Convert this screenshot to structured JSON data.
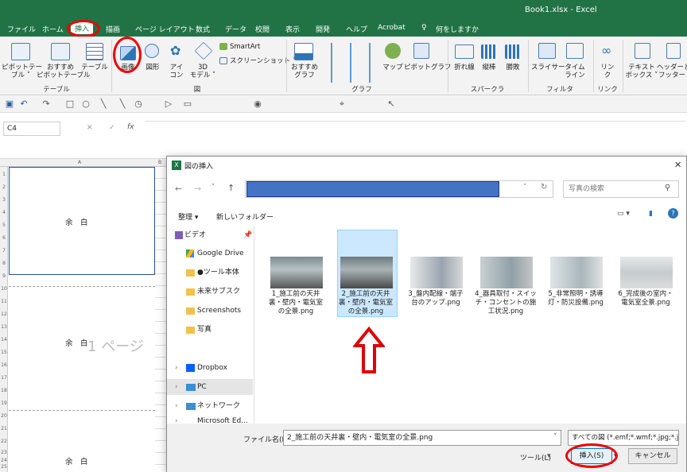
{
  "title": {
    "text": "Book1.xlsx  -  Excel"
  },
  "menu": [
    "ファイル",
    "ホーム",
    "挿入",
    "描画",
    "ページ レイアウト",
    "数式",
    "データ",
    "校閲",
    "表示",
    "開発",
    "ヘルプ",
    "Acrobat",
    "何をしますか"
  ],
  "ribbon": {
    "pivot": "ピボットテー\nブル ˅",
    "rec_pivot": "おすすめ\nピボットテーブル",
    "table": "テーブル",
    "image": "画像",
    "shape": "図形",
    "icon": "アイ\nコン",
    "model3d": "3D\nモデル ˅",
    "smartart": "SmartArt",
    "screenshot": "スクリーンショット ˅",
    "rec_chart": "おすすめ\nグラフ",
    "map": "マップ",
    "pivotchart": "ピボットグラフ",
    "line": "折れ線",
    "column": "縦棒",
    "winloss": "勝敗",
    "slicer": "スライサー",
    "timeline": "タイム\nライン",
    "link": "リン\nク",
    "textbox": "テキスト\nボックス ˅",
    "headerfooter": "ヘッダーと\nフッター",
    "group_table": "テーブル",
    "group_figure": "図",
    "group_chart": "グラフ",
    "group_spark": "スパークライン",
    "group_filter": "フィルター",
    "group_link": "リンク"
  },
  "formula": {
    "namebox": "C4",
    "fx": "fx"
  },
  "sheet": {
    "col_a": "A",
    "col_b": "B",
    "margin1": "余　白",
    "margin2": "余　白",
    "margin3": "余　白",
    "page_watermark": "1 ページ",
    "rows": [
      "1",
      "2",
      "3",
      "4",
      "5",
      "6",
      "7",
      "8",
      "9",
      "10",
      "11",
      "12",
      "13",
      "14",
      "15",
      "16",
      "17",
      "18",
      "19",
      "20",
      "21",
      "22",
      "23",
      "24",
      "25",
      "26"
    ]
  },
  "dialog": {
    "title": "図の挿入",
    "search_placeholder": "写真の検索",
    "organize": "整理 ▾",
    "new_folder": "新しいフォルダー",
    "nav": [
      "ビデオ",
      "Google Drive",
      "●ツール本体",
      "未来サブスク",
      "Screenshots",
      "写真",
      "Dropbox",
      "PC",
      "ネットワーク",
      "Microsoft Ed..."
    ],
    "files": [
      "1_施工前の天井\n裏・壁内・電気室\nの全景.png",
      "2_施工前の天井\n裏・壁内・電気室\nの全景.png",
      "3_盤内配線・端子\n台のアップ.png",
      "4_器具取付・スイッ\nチ・コンセントの施\n工状況.png",
      "5_非常照明・誘導\n灯・防災設備.png",
      "6_完成後の室内・\n電気室全景.png"
    ],
    "filename_label": "ファイル名(N):",
    "filename_value": "2_施工前の天井裏・壁内・電気室の全景.png",
    "filetype": "すべての図 (*.emf;*.wmf;*.jpg;*.j",
    "tools": "ツール(L)",
    "insert": "挿入(S)",
    "cancel": "キャンセル"
  },
  "colors": {
    "excel_green": "#217346",
    "highlight_red": "#e00000",
    "address_blue": "#4472c4",
    "selected": "#cce8ff"
  }
}
